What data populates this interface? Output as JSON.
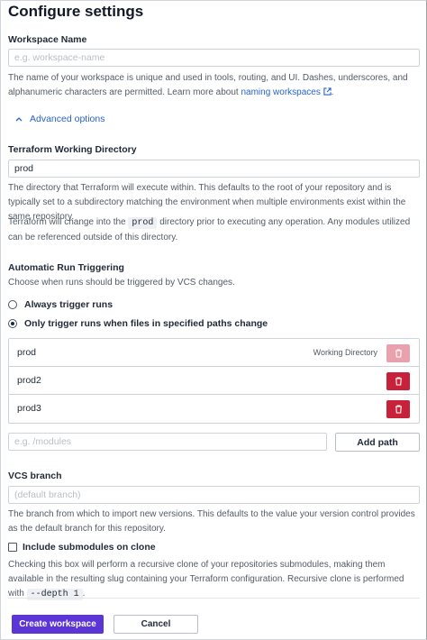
{
  "page": {
    "title": "Configure settings"
  },
  "workspace_name": {
    "label": "Workspace Name",
    "placeholder": "e.g. workspace-name",
    "help_text": "The name of your workspace is unique and used in tools, routing, and UI. Dashes, underscores, and alphanumeric characters are permitted. Learn more about ",
    "help_link": "naming workspaces"
  },
  "advanced_options": {
    "label": "Advanced options"
  },
  "working_directory": {
    "label": "Terraform Working Directory",
    "value": "prod",
    "help_text_1": "The directory that Terraform will execute within. This defaults to the root of your repository and is typically set to a subdirectory matching the environment when multiple environments exist within the same repository.",
    "help_text_2_pre": "Terraform will change into the ",
    "help_text_2_code": "prod",
    "help_text_2_post": " directory prior to executing any operation. Any modules utilized can be referenced outside of this directory."
  },
  "run_triggering": {
    "label": "Automatic Run Triggering",
    "help_text": "Choose when runs should be triggered by VCS changes.",
    "options": [
      {
        "label": "Always trigger runs",
        "selected": false
      },
      {
        "label": "Only trigger runs when files in specified paths change",
        "selected": true
      }
    ],
    "paths": [
      {
        "name": "prod",
        "tag": "Working Directory",
        "removable": false
      },
      {
        "name": "prod2",
        "removable": true
      },
      {
        "name": "prod3",
        "removable": true
      }
    ],
    "path_placeholder": "e.g. /modules",
    "add_path_label": "Add path"
  },
  "vcs_branch": {
    "label": "VCS branch",
    "placeholder": "(default branch)",
    "help_text": "The branch from which to import new versions. This defaults to the value your version control provides as the default branch for this repository."
  },
  "submodules": {
    "label": "Include submodules on clone",
    "checked": false,
    "help_text_pre": "Checking this box will perform a recursive clone of your repositories submodules, making them available in the resulting slug containing your Terraform configuration. Recursive clone is performed with ",
    "help_text_code": "--depth 1",
    "help_text_post": "."
  },
  "actions": {
    "create_label": "Create workspace",
    "cancel_label": "Cancel"
  },
  "colors": {
    "primary": "#5b35d5",
    "danger": "#c8213a",
    "link": "#2563c9"
  }
}
